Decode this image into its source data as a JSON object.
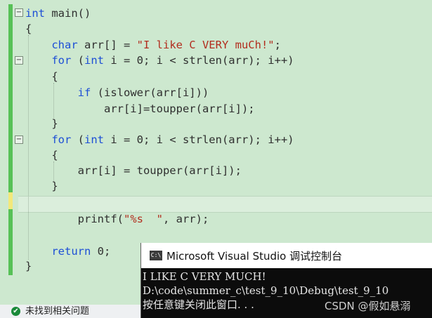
{
  "editor": {
    "lines": [
      {
        "tokens": [
          {
            "t": "int",
            "c": "kw"
          },
          {
            "t": " main()",
            "c": "id"
          }
        ]
      },
      {
        "tokens": [
          {
            "t": "{",
            "c": "id"
          }
        ]
      },
      {
        "tokens": [
          {
            "t": "    ",
            "c": "id"
          },
          {
            "t": "char",
            "c": "kw"
          },
          {
            "t": " arr[] = ",
            "c": "id"
          },
          {
            "t": "\"I like C VERY muCh!\"",
            "c": "str"
          },
          {
            "t": ";",
            "c": "id"
          }
        ]
      },
      {
        "tokens": [
          {
            "t": "    ",
            "c": "id"
          },
          {
            "t": "for",
            "c": "kw"
          },
          {
            "t": " (",
            "c": "id"
          },
          {
            "t": "int",
            "c": "kw"
          },
          {
            "t": " i = 0; i < strlen(arr); i++)",
            "c": "id"
          }
        ]
      },
      {
        "tokens": [
          {
            "t": "    {",
            "c": "id"
          }
        ]
      },
      {
        "tokens": [
          {
            "t": "        ",
            "c": "id"
          },
          {
            "t": "if",
            "c": "kw"
          },
          {
            "t": " (islower(arr[i]))",
            "c": "id"
          }
        ]
      },
      {
        "tokens": [
          {
            "t": "            arr[i]=toupper(arr[i]);",
            "c": "id"
          }
        ]
      },
      {
        "tokens": [
          {
            "t": "    }",
            "c": "id"
          }
        ]
      },
      {
        "tokens": [
          {
            "t": "    ",
            "c": "id"
          },
          {
            "t": "for",
            "c": "kw"
          },
          {
            "t": " (",
            "c": "id"
          },
          {
            "t": "int",
            "c": "kw"
          },
          {
            "t": " i = 0; i < strlen(arr); i++)",
            "c": "id"
          }
        ]
      },
      {
        "tokens": [
          {
            "t": "    {",
            "c": "id"
          }
        ]
      },
      {
        "tokens": [
          {
            "t": "        arr[i] = toupper(arr[i]);",
            "c": "id"
          }
        ]
      },
      {
        "tokens": [
          {
            "t": "    }",
            "c": "id"
          }
        ]
      },
      {
        "tokens": []
      },
      {
        "tokens": []
      },
      {
        "tokens": [
          {
            "t": "        printf(",
            "c": "id"
          },
          {
            "t": "\"%s  \"",
            "c": "str"
          },
          {
            "t": ", arr);",
            "c": "id"
          }
        ]
      },
      {
        "tokens": []
      },
      {
        "tokens": [
          {
            "t": "    ",
            "c": "id"
          },
          {
            "t": "return",
            "c": "kw"
          },
          {
            "t": " 0;",
            "c": "id"
          }
        ]
      },
      {
        "tokens": [
          {
            "t": "}",
            "c": "id"
          }
        ]
      }
    ]
  },
  "status": {
    "message": "未找到相关问题"
  },
  "console": {
    "app_icon_label": "C:\\",
    "title": "Microsoft Visual Studio 调试控制台",
    "output_lines": [
      "I LIKE C VERY MUCH!",
      "D:\\code\\summer_c\\test_9_10\\Debug\\test_9_10",
      "按任意键关闭此窗口. . ."
    ]
  },
  "watermark": "CSDN @假如悬溺",
  "colors": {
    "editor_bg": "#cde8cf",
    "keyword": "#1d4fd6",
    "string": "#b22d1e",
    "changed_bar": "#57c157",
    "console_bg": "#0c0c0c"
  }
}
